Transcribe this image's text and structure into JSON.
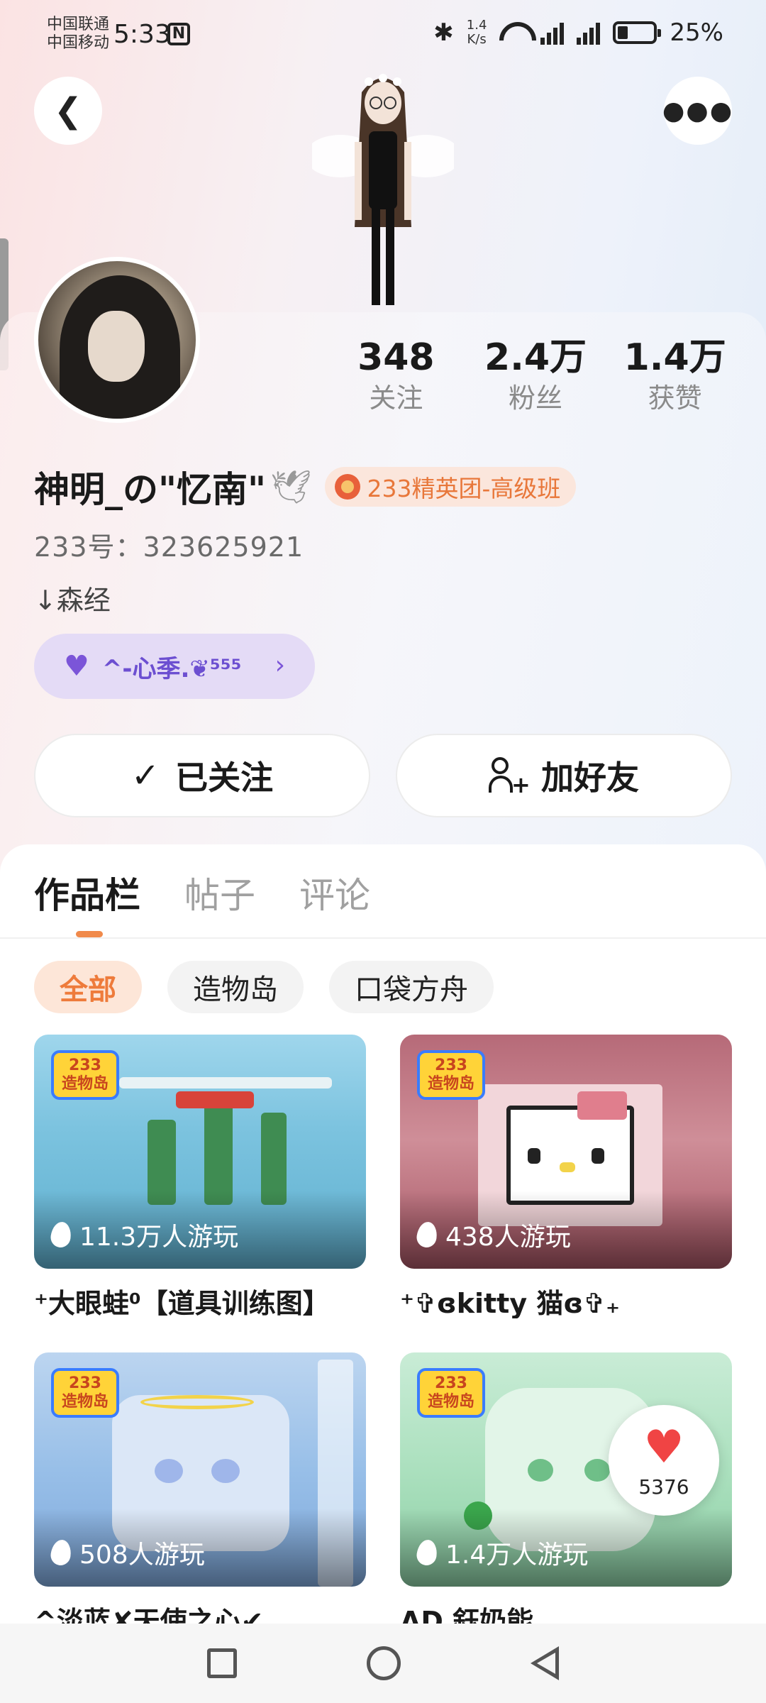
{
  "status_bar": {
    "carrier_1": "中国联通",
    "carrier_2": "中国移动",
    "time": "5:33",
    "speed_value": "1.4",
    "speed_unit": "K/s",
    "battery": "25%"
  },
  "profile": {
    "stats": [
      {
        "value": "348",
        "label": "关注"
      },
      {
        "value": "2.4万",
        "label": "粉丝"
      },
      {
        "value": "1.4万",
        "label": "获赞"
      }
    ],
    "name": "神明_の\"忆南\"",
    "badge": "233精英团-高级班",
    "user_id": "233号：323625921",
    "signature": "↓森经",
    "club": "^-心季.❦⁵⁵⁵"
  },
  "actions": {
    "follow_label": "已关注",
    "add_friend_label": "加好友"
  },
  "tabs": [
    "作品栏",
    "帖子",
    "评论"
  ],
  "filters": [
    "全部",
    "造物岛",
    "口袋方舟"
  ],
  "works": [
    {
      "plays": "11.3万人游玩",
      "title": "⁺大眼蛙⁰【道具训练图】"
    },
    {
      "plays": "438人游玩",
      "title": "⁺✞ɞkitty 猫ɞ✞₊"
    },
    {
      "plays": "508人游玩",
      "title": "^淡蓝✘天使之心✔"
    },
    {
      "plays": "1.4万人游玩",
      "title": "AD 鈺奶能"
    }
  ],
  "logo_text": [
    "233",
    "造物岛"
  ],
  "like_float": {
    "count": "5376"
  },
  "colors": {
    "accent": "#ee7b3b",
    "club": "#6c4fd1",
    "like": "#f04444"
  }
}
